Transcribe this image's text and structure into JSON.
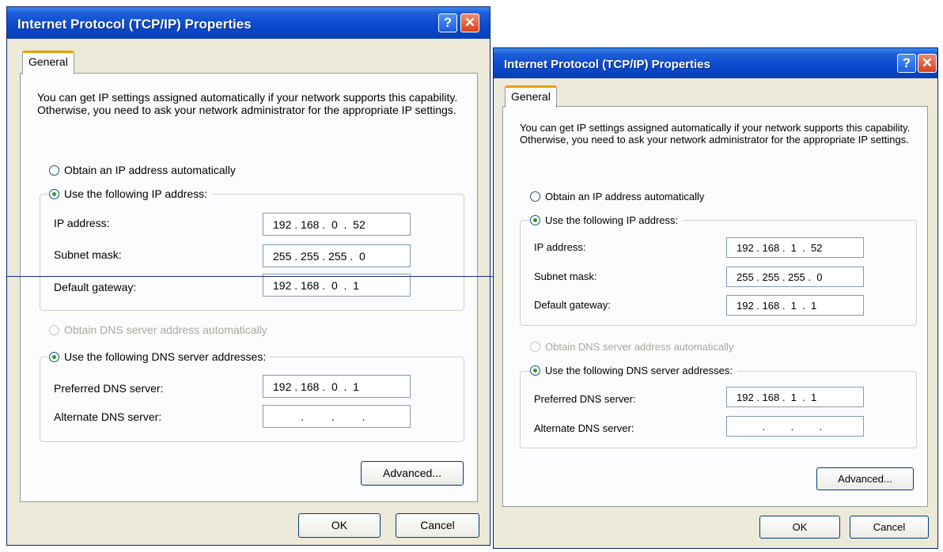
{
  "dialogs": [
    {
      "title": "Internet Protocol (TCP/IP) Properties",
      "help_glyph": "?",
      "close_glyph": "✕",
      "tab_label": "General",
      "description": "You can get IP settings assigned automatically if your network supports this capability. Otherwise, you need to ask your network administrator for the appropriate IP settings.",
      "radio_obtain_ip": "Obtain an IP address automatically",
      "radio_use_ip": "Use the following IP address:",
      "ip_label": "IP address:",
      "ip_value": "192 . 168 .  0  .  52",
      "subnet_label": "Subnet mask:",
      "subnet_value": "255 . 255 . 255 .  0",
      "gateway_label": "Default gateway:",
      "gateway_value": "192 . 168 .  0  .  1",
      "radio_obtain_dns": "Obtain DNS server address automatically",
      "radio_use_dns": "Use the following DNS server addresses:",
      "preferred_label": "Preferred DNS server:",
      "preferred_value": "192 . 168 .  0  .  1",
      "alternate_label": "Alternate DNS server:",
      "alternate_value": "         .         .         .",
      "advanced_label": "Advanced...",
      "ok_label": "OK",
      "cancel_label": "Cancel"
    },
    {
      "title": "Internet Protocol (TCP/IP) Properties",
      "help_glyph": "?",
      "close_glyph": "✕",
      "tab_label": "General",
      "description": "You can get IP settings assigned automatically if your network supports this capability. Otherwise, you need to ask your network administrator for the appropriate IP settings.",
      "radio_obtain_ip": "Obtain an IP address automatically",
      "radio_use_ip": "Use the following IP address:",
      "ip_label": "IP address:",
      "ip_value": "192 . 168 .  1  .  52",
      "subnet_label": "Subnet mask:",
      "subnet_value": "255 . 255 . 255 .  0",
      "gateway_label": "Default gateway:",
      "gateway_value": "192 . 168 .  1  .  1",
      "radio_obtain_dns": "Obtain DNS server address automatically",
      "radio_use_dns": "Use the following DNS server addresses:",
      "preferred_label": "Preferred DNS server:",
      "preferred_value": "192 . 168 .  1  .  1",
      "alternate_label": "Alternate DNS server:",
      "alternate_value": "         .         .         .",
      "advanced_label": "Advanced...",
      "ok_label": "OK",
      "cancel_label": "Cancel"
    }
  ],
  "colors": {
    "titlebar": "#0b4bd0",
    "dialog_face": "#ece9d8",
    "panel": "#fcfcfe",
    "tab_highlight": "#e6a100",
    "selected_radio": "#21a121",
    "disabled_text": "#a8a89a",
    "overlay_line": "#1a2aa8"
  },
  "icons": {
    "help": "help-question-icon",
    "close": "close-x-icon"
  }
}
